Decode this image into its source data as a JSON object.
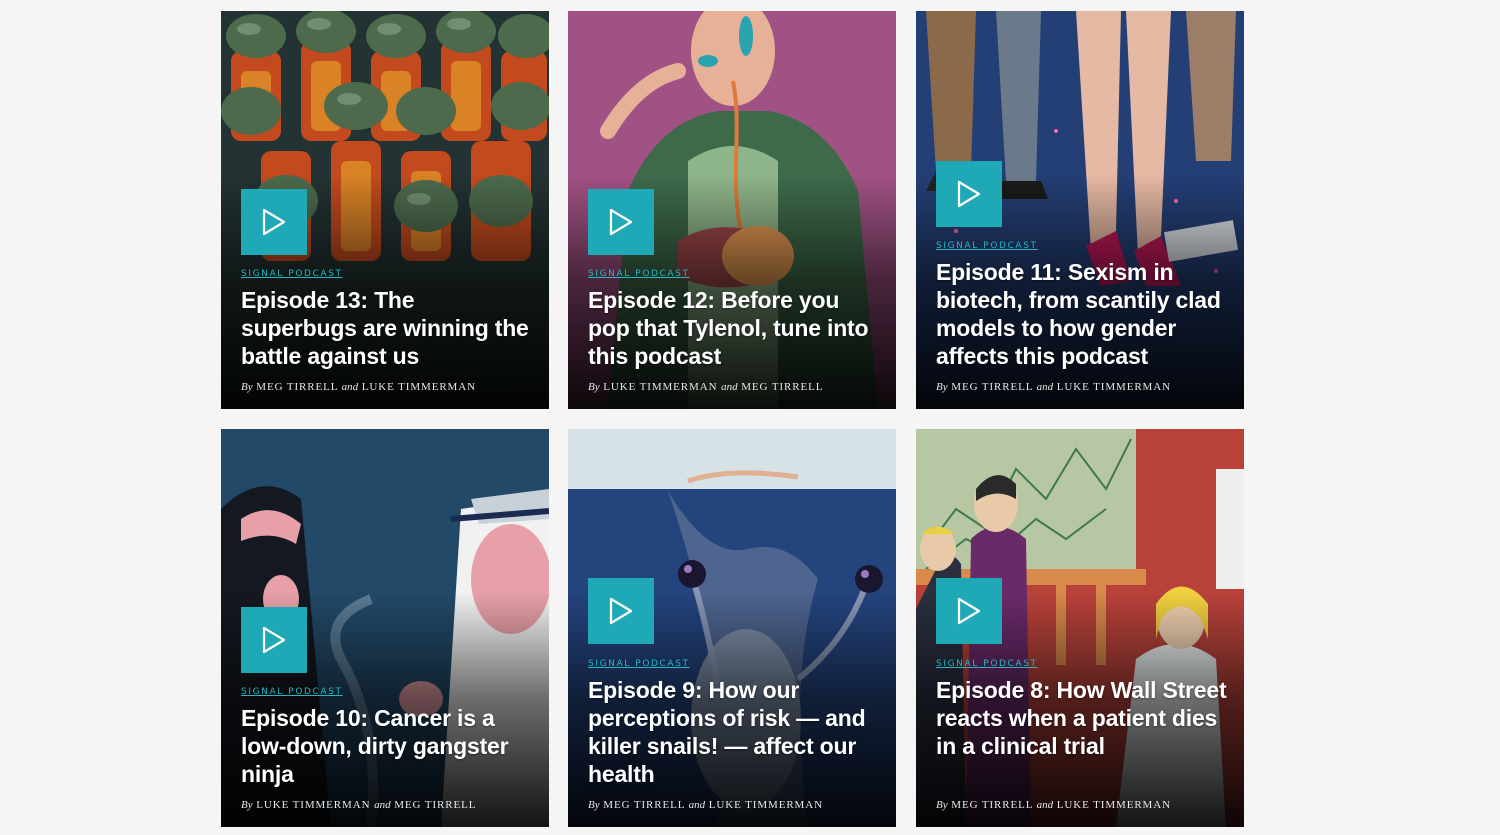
{
  "kicker": "SIGNAL PODCAST",
  "byline_by": "By",
  "byline_and": "and",
  "accent_color": "#1fa9b6",
  "episodes": [
    {
      "title": "Episode 13: The superbugs are winning the battle against us",
      "author1": "MEG TIRRELL",
      "author2": "LUKE TIMMERMAN",
      "icon": "play-icon"
    },
    {
      "title": "Episode 12: Before you pop that Tylenol, tune into this podcast",
      "author1": "LUKE TIMMERMAN",
      "author2": "MEG TIRRELL",
      "icon": "play-icon"
    },
    {
      "title": "Episode 11: Sexism in biotech, from scantily clad models to how gender affects this podcast",
      "author1": "MEG TIRRELL",
      "author2": "LUKE TIMMERMAN",
      "icon": "play-icon"
    },
    {
      "title": "Episode 10: Cancer is a low-down, dirty gangster ninja",
      "author1": "LUKE TIMMERMAN",
      "author2": "MEG TIRRELL",
      "icon": "play-icon"
    },
    {
      "title": "Episode 9: How our perceptions of risk — and killer snails! — affect our health",
      "author1": "MEG TIRRELL",
      "author2": "LUKE TIMMERMAN",
      "icon": "play-icon"
    },
    {
      "title": "Episode 8: How Wall Street reacts when a patient dies in a clinical trial",
      "author1": "MEG TIRRELL",
      "author2": "LUKE TIMMERMAN",
      "icon": "play-icon"
    }
  ]
}
